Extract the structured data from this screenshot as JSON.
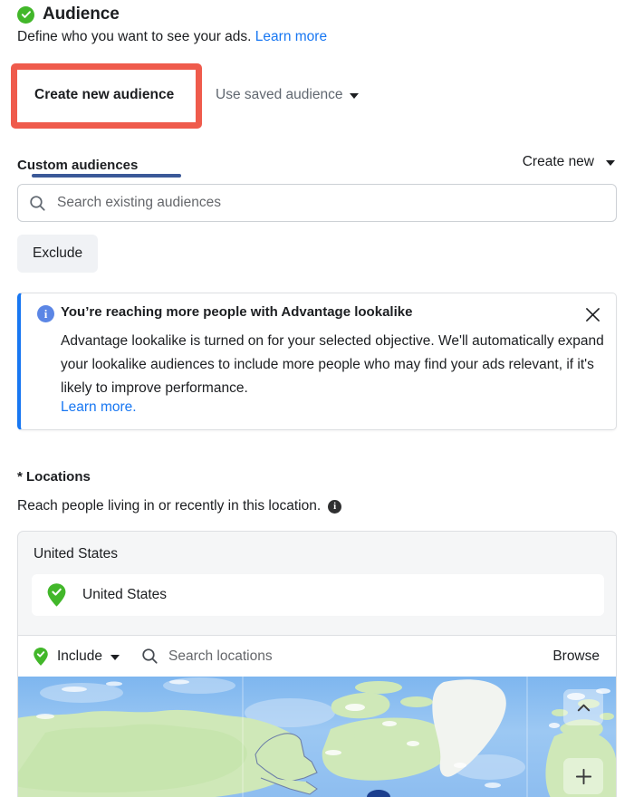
{
  "header": {
    "status_icon": "check-circle-icon",
    "title": "Audience",
    "subtitle": "Define who you want to see your ads.",
    "learn_more": "Learn more"
  },
  "tabs": {
    "active_index": 0,
    "items": [
      {
        "label": "Create new audience",
        "has_caret": false
      },
      {
        "label": "Use saved audience",
        "has_caret": true
      }
    ],
    "highlight_color": "#ef5b4c",
    "active_bar_color": "#3b5998"
  },
  "custom_audiences": {
    "label": "Custom audiences",
    "create_new_label": "Create new",
    "create_new_icon": "chevron-down-icon",
    "search": {
      "icon": "search-icon",
      "placeholder": "Search existing audiences",
      "value": ""
    },
    "exclude_label": "Exclude"
  },
  "info_banner": {
    "icon": "info-circle-icon",
    "title": "You’re reaching more people with Advantage lookalike",
    "body": "Advantage lookalike is turned on for your selected objective. We'll automatically expand your lookalike audiences to include more people who may find your ads relevant, if it's likely to improve performance.",
    "learn_more": "Learn more.",
    "close_icon": "close-icon",
    "accent_color": "#1877f2"
  },
  "locations": {
    "title": "* Locations",
    "description": "Reach people living in or recently in this location.",
    "info_icon": "info-icon",
    "group_label": "United States",
    "selected": [
      {
        "label": "United States",
        "icon": "map-pin-check-icon"
      }
    ],
    "toolbar": {
      "include_label": "Include",
      "include_icon": "map-pin-check-icon",
      "include_caret": "chevron-down-icon",
      "search_icon": "search-icon",
      "search_placeholder": "Search locations",
      "search_value": "",
      "browse_label": "Browse"
    },
    "map": {
      "collapse_icon": "chevron-up-icon",
      "zoom_in_icon": "plus-icon",
      "water_color": "#9ec8f5",
      "land_color": "#cfe8b8",
      "ice_color": "#f2f4f0"
    }
  }
}
